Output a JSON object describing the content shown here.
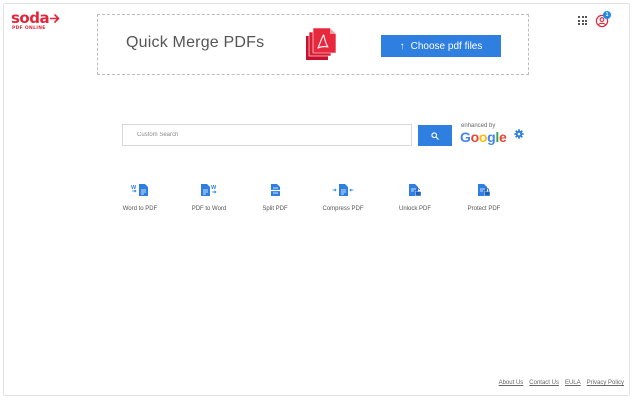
{
  "logo": {
    "brand": "soda",
    "sub": "PDF ONLINE"
  },
  "header": {
    "notification_count": "1"
  },
  "banner": {
    "title": "Quick Merge PDFs",
    "button_label": "Choose pdf files"
  },
  "search": {
    "placeholder": "Custom Search",
    "enhanced_by": "enhanced by"
  },
  "tools": [
    {
      "label": "Word to PDF"
    },
    {
      "label": "PDF to Word"
    },
    {
      "label": "Split PDF"
    },
    {
      "label": "Compress PDF"
    },
    {
      "label": "Unlock PDF"
    },
    {
      "label": "Protect PDF"
    }
  ],
  "footer": {
    "links": [
      "About Us",
      "Contact Us",
      "EULA",
      "Privacy Policy"
    ]
  },
  "colors": {
    "brand_red": "#e2263a",
    "accent_blue": "#2f7fe0"
  }
}
